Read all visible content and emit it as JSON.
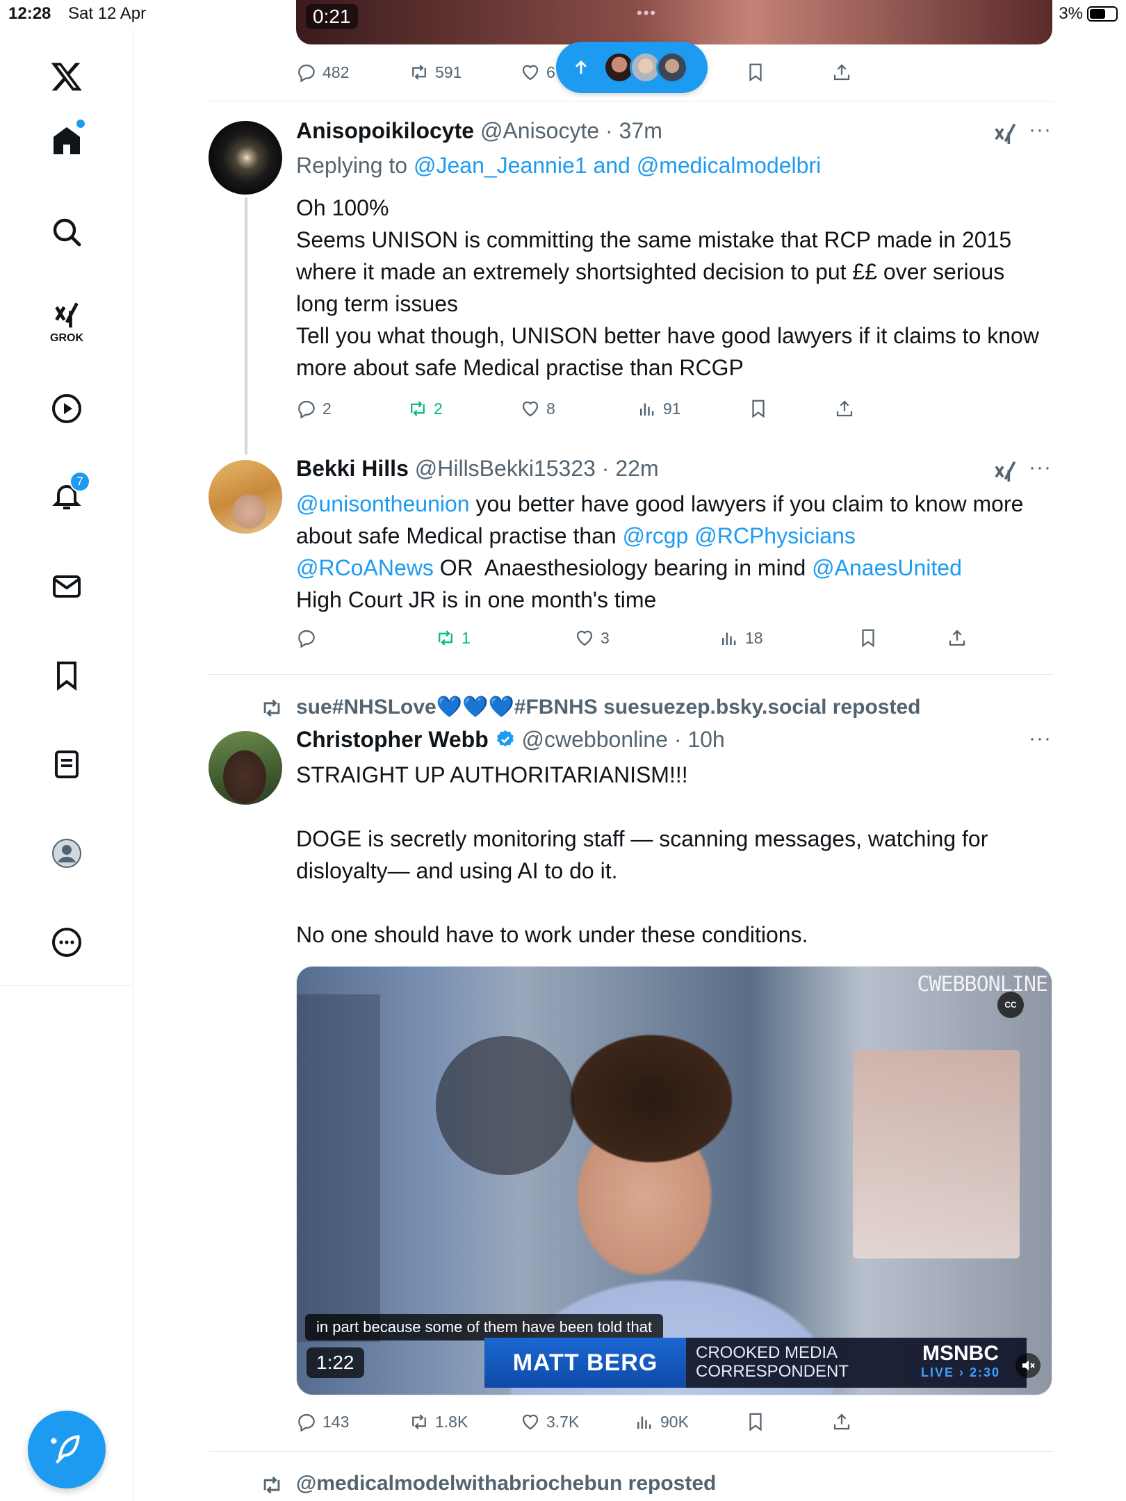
{
  "status_bar": {
    "time": "12:28",
    "date": "Sat 12 Apr",
    "battery": "3%"
  },
  "sidebar": {
    "grok_label": "GROK",
    "notifications_badge": "7",
    "items": [
      "home",
      "explore",
      "grok",
      "video",
      "notifications",
      "messages",
      "bookmarks",
      "lists",
      "profile",
      "more"
    ]
  },
  "top_post": {
    "video_time": "0:21",
    "replies": "482",
    "reposts": "591",
    "likes": "6"
  },
  "tweets": [
    {
      "name": "Anisopoikilocyte",
      "handle": "@Anisocyte",
      "time": "· 37m",
      "replying_prefix": "Replying to ",
      "replying_user1": "@Jean_Jeannie1",
      "replying_and": " and ",
      "replying_user2": "@medicalmodelbri",
      "text": "Oh 100%\nSeems UNISON is committing the same mistake that RCP made in 2015 where it made an extremely shortsighted decision to put ££ over serious long term issues\nTell you what though, UNISON better have good lawyers if it claims to know more about safe Medical practise than RCGP",
      "replies": "2",
      "reposts": "2",
      "likes": "8",
      "views": "91"
    },
    {
      "name": "Bekki Hills",
      "handle": "@HillsBekki15323",
      "time": "· 22m",
      "mention1": "@unisontheunion",
      "text1": " you better have good lawyers if you claim to know more about safe Medical practise than ",
      "mention2": "@rcgp",
      "mention3": "@RCPhysicians",
      "mention4": "@RCoANews",
      "text2": " OR  Anaesthesiology bearing in mind ",
      "mention5": "@AnaesUnited",
      "text3": "High Court JR is in one month's time",
      "replies": "",
      "reposts": "1",
      "likes": "3",
      "views": "18"
    },
    {
      "repost_by": "sue#NHSLove💙💙💙#FBNHS suesuezep.bsky.social reposted",
      "name": "Christopher Webb",
      "handle": "@cwebbonline",
      "time": "· 10h",
      "text": "STRAIGHT UP AUTHORITARIANISM!!!\n\nDOGE is secretly monitoring staff — scanning messages, watching for disloyalty— and using AI to do it.\n\nNo one should have to work under these conditions.",
      "video": {
        "watermark": "CWEBBONLINE",
        "caption": "in part because some of them have been told that",
        "lower_third_name": "MATT BERG",
        "lower_third_title_1": "CROOKED MEDIA",
        "lower_third_title_2": "CORRESPONDENT",
        "brand": "MSNBC",
        "live": "LIVE › 2:30",
        "duration": "1:22",
        "cc": "CC"
      },
      "replies": "143",
      "reposts": "1.8K",
      "likes": "3.7K",
      "views": "90K"
    }
  ],
  "next_repost": "@medicalmodelwithabriochebun reposted"
}
